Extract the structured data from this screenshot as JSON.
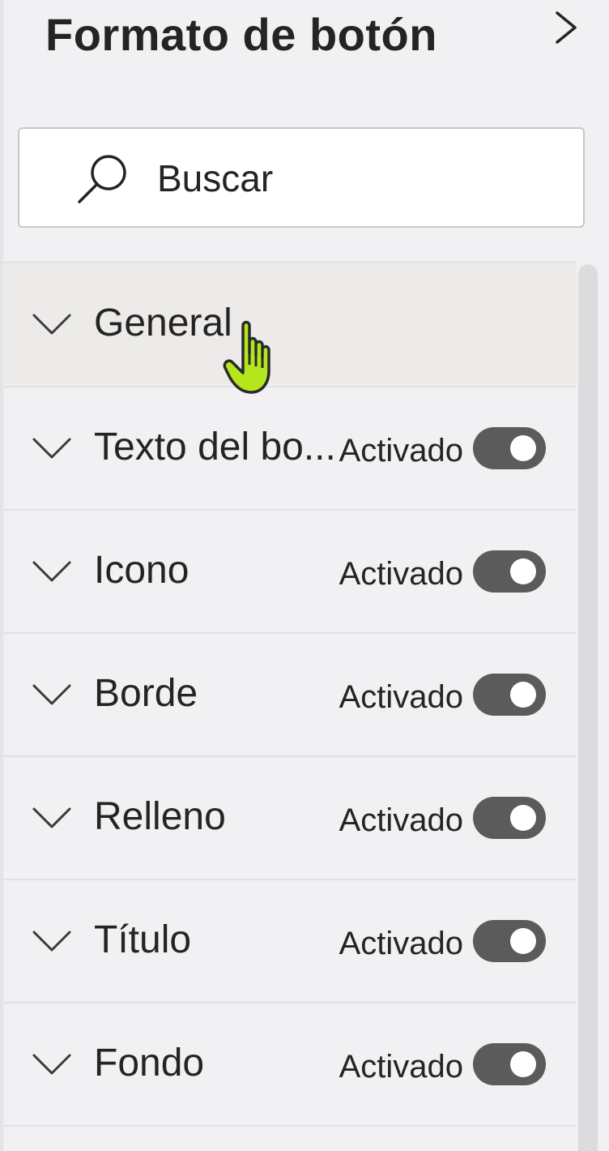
{
  "panel": {
    "title": "Formato de botón"
  },
  "search": {
    "placeholder": "Buscar",
    "value": ""
  },
  "sections": [
    {
      "label": "General",
      "state": "",
      "toggle_on": null
    },
    {
      "label": "Texto del bo...",
      "state": "Activado",
      "toggle_on": true
    },
    {
      "label": "Icono",
      "state": "Activado",
      "toggle_on": true
    },
    {
      "label": "Borde",
      "state": "Activado",
      "toggle_on": true
    },
    {
      "label": "Relleno",
      "state": "Activado",
      "toggle_on": true
    },
    {
      "label": "Título",
      "state": "Activado",
      "toggle_on": true
    },
    {
      "label": "Fondo",
      "state": "Activado",
      "toggle_on": true
    }
  ],
  "icons": {
    "header": "chevron-right-icon",
    "search": "search-icon",
    "section_expander": "chevron-down-icon",
    "pointer": "hand-pointer-icon"
  },
  "colors": {
    "toggle_on": "#5b5b5b",
    "cursor_highlight": "#b5e61d"
  }
}
